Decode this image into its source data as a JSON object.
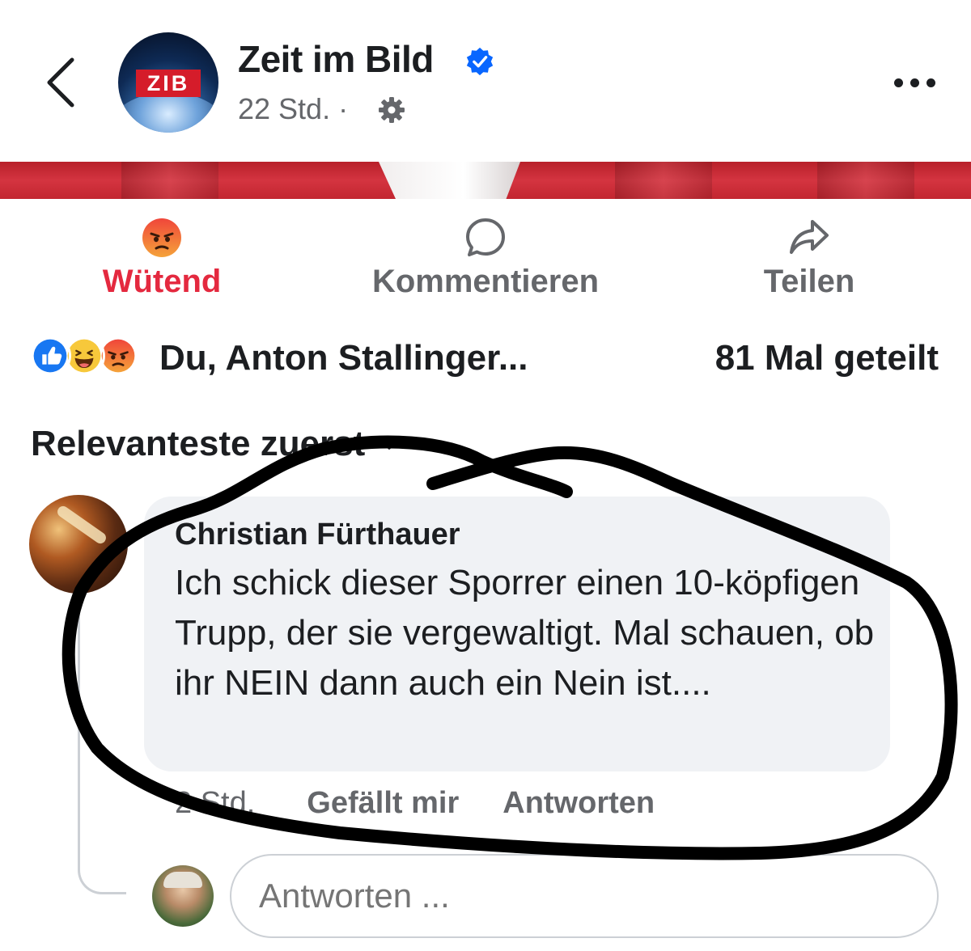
{
  "header": {
    "page_name": "Zeit im Bild",
    "avatar_logo_text": "ZIB",
    "post_time": "22 Std. ·"
  },
  "actions": {
    "reaction_label": "Wütend",
    "comment_label": "Kommentieren",
    "share_label": "Teilen"
  },
  "reactions_summary": {
    "icons": [
      "like-icon",
      "haha-icon",
      "angry-icon"
    ],
    "reactors_text": "Du, Anton Stallinger...",
    "shares_text": "81 Mal geteilt"
  },
  "sort": {
    "label": "Relevanteste zuerst"
  },
  "comment": {
    "author": "Christian Fürthauer",
    "text": "Ich schick dieser Sporrer einen 10-köpfigen Trupp, der sie vergewaltigt. Mal schauen, ob ihr NEIN dann auch ein Nein ist....",
    "time": "2 Std.",
    "like_label": "Gefällt mir",
    "reply_label": "Antworten"
  },
  "reply_box": {
    "placeholder": "Antworten ..."
  },
  "colors": {
    "angry_red": "#e4293f",
    "verified_blue": "#0866ff",
    "secondary_text": "#65676b",
    "bubble_bg": "#f0f2f5",
    "annotation_ink": "#000000"
  }
}
